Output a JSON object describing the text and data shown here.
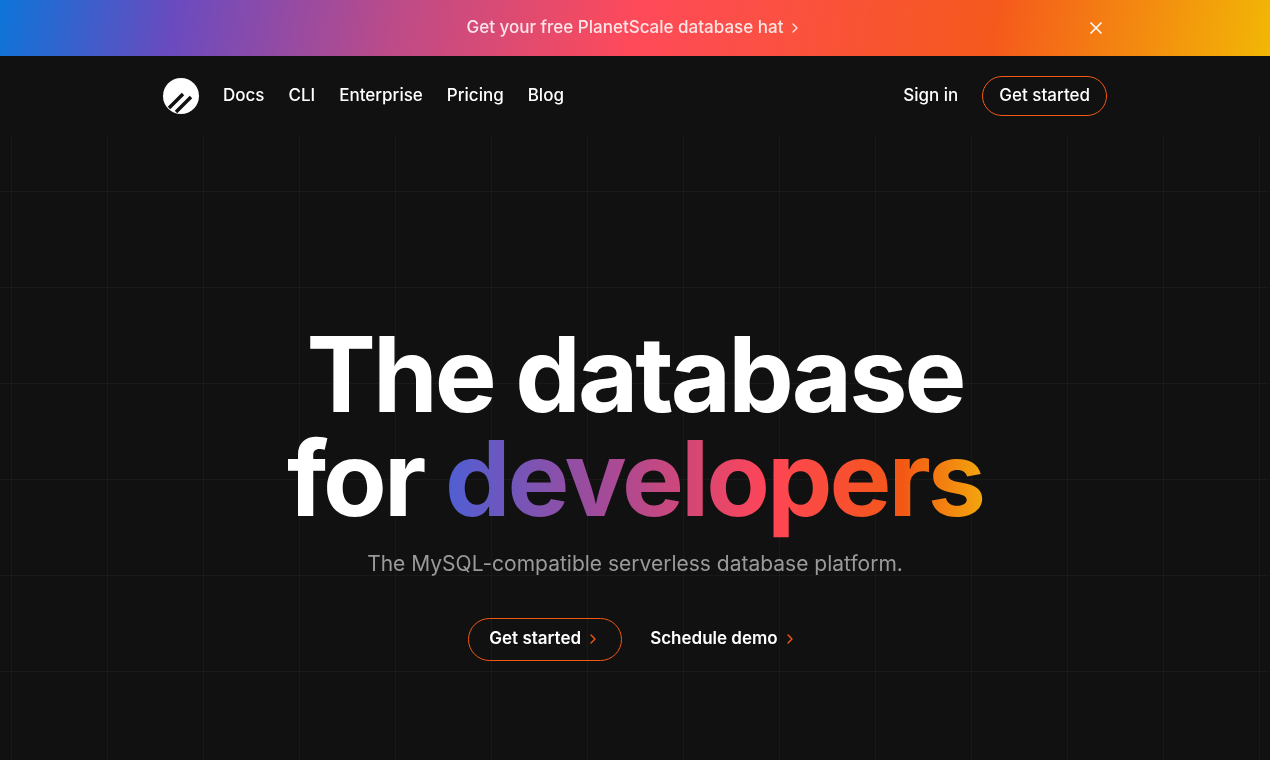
{
  "banner": {
    "text": "Get your free PlanetScale database hat"
  },
  "nav": {
    "links": [
      "Docs",
      "CLI",
      "Enterprise",
      "Pricing",
      "Blog"
    ],
    "sign_in": "Sign in",
    "cta": "Get started"
  },
  "hero": {
    "title_line_1": "The database",
    "title_line_2_prefix": "for",
    "title_highlight": "developers",
    "subtitle": "The MySQL-compatible serverless database platform.",
    "actions": [
      {
        "label": "Get started",
        "kind": "outlined"
      },
      {
        "label": "Schedule demo",
        "kind": "plain"
      }
    ]
  }
}
